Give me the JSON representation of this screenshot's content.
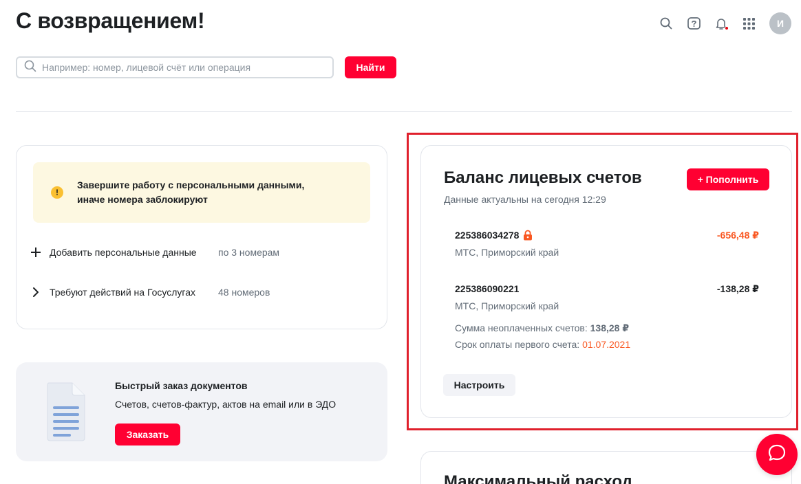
{
  "header": {
    "title": "С возвращением!",
    "avatar_initial": "И",
    "icons": [
      "search-icon",
      "help-icon",
      "bell-icon",
      "apps-grid-icon"
    ]
  },
  "search": {
    "placeholder": "Например: номер, лицевой счёт или операция",
    "button_label": "Найти"
  },
  "personal": {
    "warning_line1": "Завершите работу с персональными данными,",
    "warning_line2": "иначе номера заблокируют",
    "actions": [
      {
        "label": "Добавить персональные данные",
        "count": "по 3 номерам",
        "icon": "plus-icon"
      },
      {
        "label": "Требуют действий на Госуслугах",
        "count": "48 номеров",
        "icon": "chevron-right-icon"
      }
    ]
  },
  "docs": {
    "title": "Быстрый заказ документов",
    "subtitle": "Счетов, счетов-фактур, актов на email или в ЭДО",
    "button_label": "Заказать"
  },
  "balance": {
    "title": "Баланс лицевых счетов",
    "subtitle": "Данные актуальны на сегодня 12:29",
    "topup_label": "+ Пополнить",
    "accounts": [
      {
        "number": "225386034278",
        "region": "МТС, Приморский край",
        "amount": "-656,48 ₽",
        "locked": true
      },
      {
        "number": "225386090221",
        "region": "МТС, Приморский край",
        "amount": "-138,28 ₽",
        "locked": false
      }
    ],
    "unpaid_label": "Сумма неоплаченных счетов:",
    "unpaid_value": "138,28 ₽",
    "due_label": "Срок оплаты первого счета:",
    "due_date": "01.07.2021",
    "configure_label": "Настроить"
  },
  "max_spend": {
    "title": "Максимальный расход"
  },
  "colors": {
    "brand_red": "#ff0032",
    "negative_amount": "#f95721",
    "warning_bg": "#fdf8e1",
    "highlight_border": "#e0202c"
  }
}
